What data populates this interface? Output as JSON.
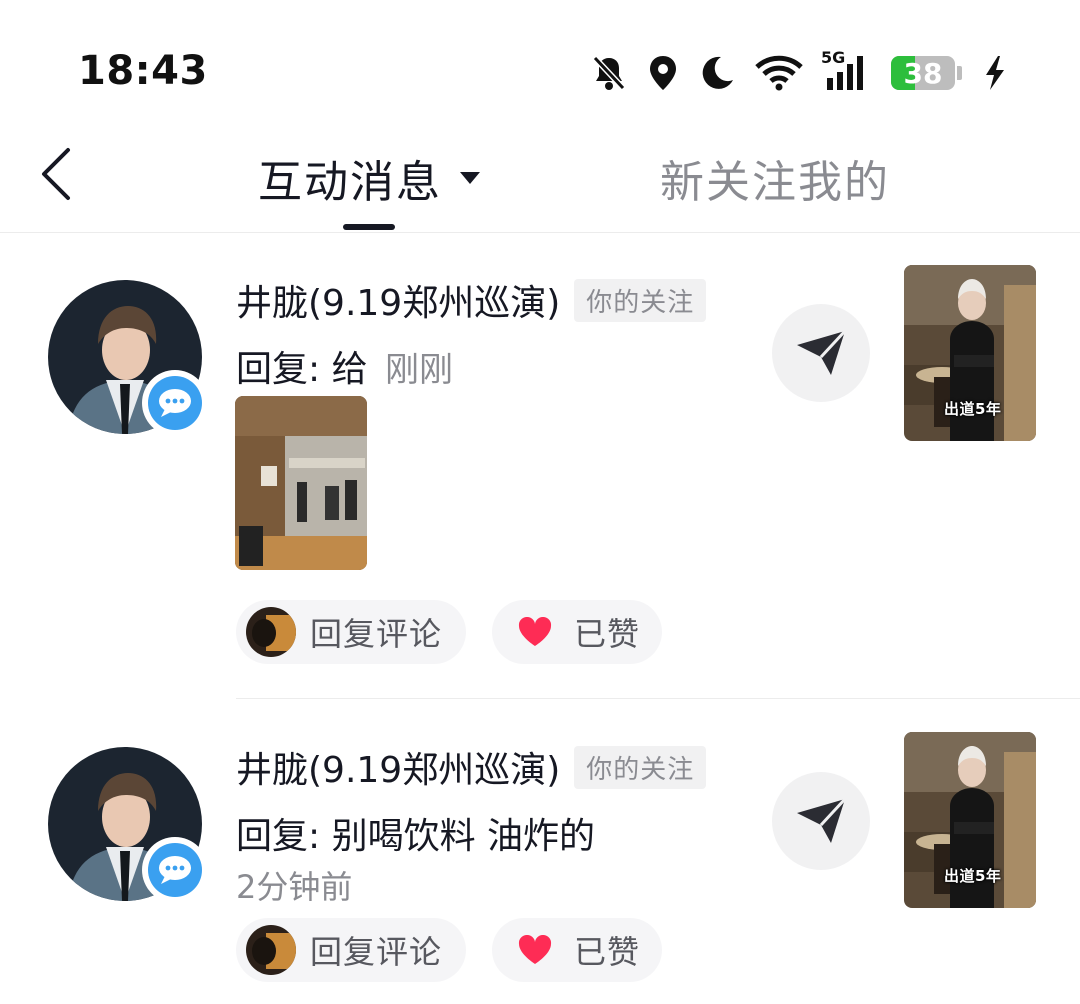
{
  "status_bar": {
    "time": "18:43",
    "network": "5G",
    "battery_level": 38,
    "icons": [
      "bell-muted-icon",
      "location-icon",
      "moon-icon",
      "wifi-icon",
      "signal-icon",
      "battery-icon",
      "charging-bolt-icon"
    ]
  },
  "nav": {
    "back_icon": "chevron-left-icon",
    "active_tab": "互动消息",
    "other_tab": "新关注我的"
  },
  "messages": [
    {
      "name": "井胧(9.19郑州巡演)",
      "tag": "你的关注",
      "reply_text": "回复: 给",
      "time": "刚刚",
      "has_image": true,
      "reply_button": "回复评论",
      "like_button": "已赞",
      "thumb_label": "出道5年"
    },
    {
      "name": "井胧(9.19郑州巡演)",
      "tag": "你的关注",
      "reply_text": "回复: 别喝饮料 油炸的",
      "time": "2分钟前",
      "has_image": false,
      "reply_button": "回复评论",
      "like_button": "已赞",
      "thumb_label": "出道5年"
    }
  ],
  "colors": {
    "text_primary": "#161823",
    "text_secondary": "#8a8b91",
    "badge_blue": "#3aa0f0",
    "heart_red": "#fe2c55",
    "battery_green": "#2dbe3c"
  }
}
